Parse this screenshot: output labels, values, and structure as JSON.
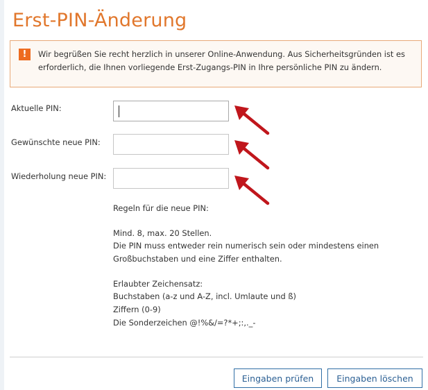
{
  "page": {
    "title": "Erst-PIN-Änderung"
  },
  "notice": {
    "icon": "warning-icon",
    "icon_glyph": "!",
    "text": "Wir begrüßen Sie recht herzlich in unserer Online-Anwendung. Aus Sicherheitsgründen ist es erforderlich, die Ihnen vorliegende Erst-Zugangs-PIN in Ihre persönliche PIN zu ändern."
  },
  "form": {
    "current_pin": {
      "label": "Aktuelle PIN:",
      "value": ""
    },
    "new_pin": {
      "label": "Gewünschte neue PIN:",
      "value": ""
    },
    "repeat_pin": {
      "label": "Wiederholung neue PIN:",
      "value": ""
    }
  },
  "rules": {
    "heading": "Regeln für die neue PIN:",
    "length": "Mind. 8, max. 20 Stellen.",
    "composition_1": "Die PIN muss entweder rein numerisch sein oder mindestens einen",
    "composition_2": "Großbuchstaben und eine Ziffer enthalten.",
    "charset_heading": "Erlaubter Zeichensatz:",
    "charset_letters": "Buchstaben (a-z und A-Z, incl. Umlaute und ß)",
    "charset_digits": "Ziffern (0-9)",
    "charset_special": "Die Sonderzeichen @!%&/=?*+;:,._-"
  },
  "actions": {
    "check_label": "Eingaben prüfen",
    "clear_label": "Eingaben löschen"
  },
  "colors": {
    "title": "#e1772c",
    "notice_border": "#e8a978",
    "notice_icon": "#ee6b1f",
    "arrow": "#c0161c",
    "button_border": "#2f6ea5"
  }
}
